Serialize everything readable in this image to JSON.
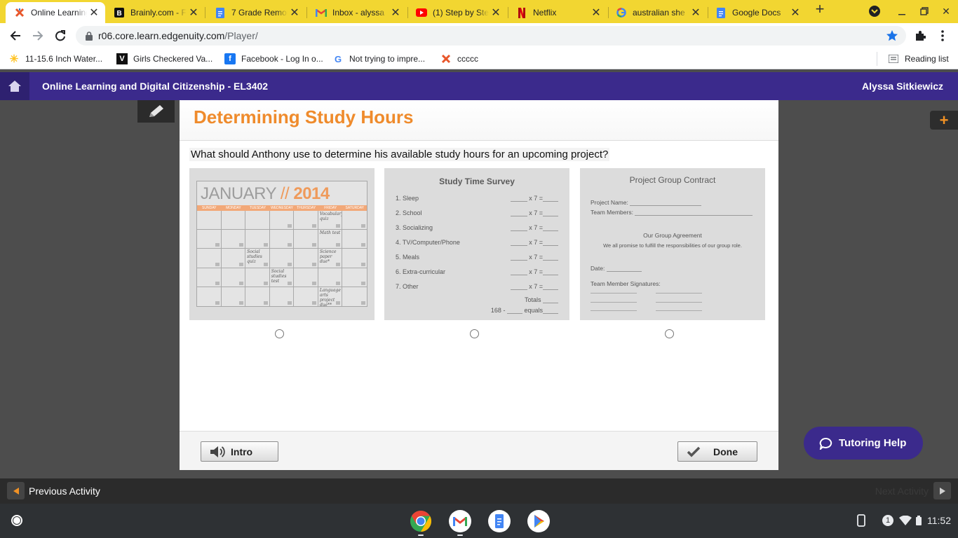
{
  "browser": {
    "tabs": [
      {
        "title": "Online Learning",
        "icon": "edgenuity-favicon",
        "active": true
      },
      {
        "title": "Brainly.com - F",
        "icon": "brainly-favicon"
      },
      {
        "title": "7 Grade Remot",
        "icon": "google-docs-favicon"
      },
      {
        "title": "Inbox - alyssa",
        "icon": "gmail-favicon"
      },
      {
        "title": "(1) Step by Ste",
        "icon": "youtube-favicon"
      },
      {
        "title": "Netflix",
        "icon": "netflix-favicon"
      },
      {
        "title": "australian she",
        "icon": "google-favicon"
      },
      {
        "title": "Google Docs",
        "icon": "google-docs-favicon"
      }
    ],
    "address": {
      "host": "r06.core.learn.edgenuity.com",
      "path": "/Player/"
    },
    "bookmarks": [
      {
        "label": "11-15.6 Inch Water...",
        "icon": "walmart-spark-icon"
      },
      {
        "label": "Girls Checkered Va...",
        "icon": "vans-icon"
      },
      {
        "label": "Facebook - Log In o...",
        "icon": "facebook-icon"
      },
      {
        "label": "Not trying to impre...",
        "icon": "google-g-icon"
      },
      {
        "label": "ccccc",
        "icon": "edgenuity-icon"
      }
    ],
    "reading_list": "Reading list"
  },
  "app": {
    "course_title": "Online Learning and Digital Citizenship - EL3402",
    "user_name": "Alyssa Sitkiewicz"
  },
  "lesson": {
    "title": "Determining Study Hours",
    "question": "What should Anthony use to determine his available study hours for an upcoming project?",
    "calendar": {
      "month": "JANUARY",
      "separator": "//",
      "year": "2014",
      "days": [
        "SUNDAY",
        "MONDAY",
        "TUESDAY",
        "WEDNESDAY",
        "THURSDAY",
        "FRIDAY",
        "SATURDAY"
      ],
      "notes": {
        "r0c5": "Vocabulary quiz",
        "r1c5": "Math test",
        "r2c2": "Social studies quiz",
        "r2c5": "Science paper due*",
        "r3c3": "Social studies test",
        "r4c5": "Language arts project due**"
      }
    },
    "survey": {
      "title": "Study Time Survey",
      "rows": [
        "1. Sleep",
        "2. School",
        "3. Socializing",
        "4. TV/Computer/Phone",
        "5. Meals",
        "6. Extra-curricular",
        "7. Other"
      ],
      "multiplier": "x 7 =",
      "totals": "Totals",
      "subtract": "168 -",
      "equals": "equals"
    },
    "contract": {
      "title": "Project Group Contract",
      "project_name": "Project Name:",
      "team_members": "Team Members:",
      "agreement_heading": "Our Group Agreement",
      "agreement_text": "We all promise to fulfill the responsibilities of our group role.",
      "date": "Date:",
      "signatures": "Team Member Signatures:"
    },
    "buttons": {
      "intro": "Intro",
      "done": "Done"
    }
  },
  "navigation": {
    "previous": "Previous Activity",
    "next": "Next Activity"
  },
  "tutoring": {
    "label": "Tutoring Help"
  },
  "system": {
    "time": "11:52",
    "notification_count": "1"
  }
}
